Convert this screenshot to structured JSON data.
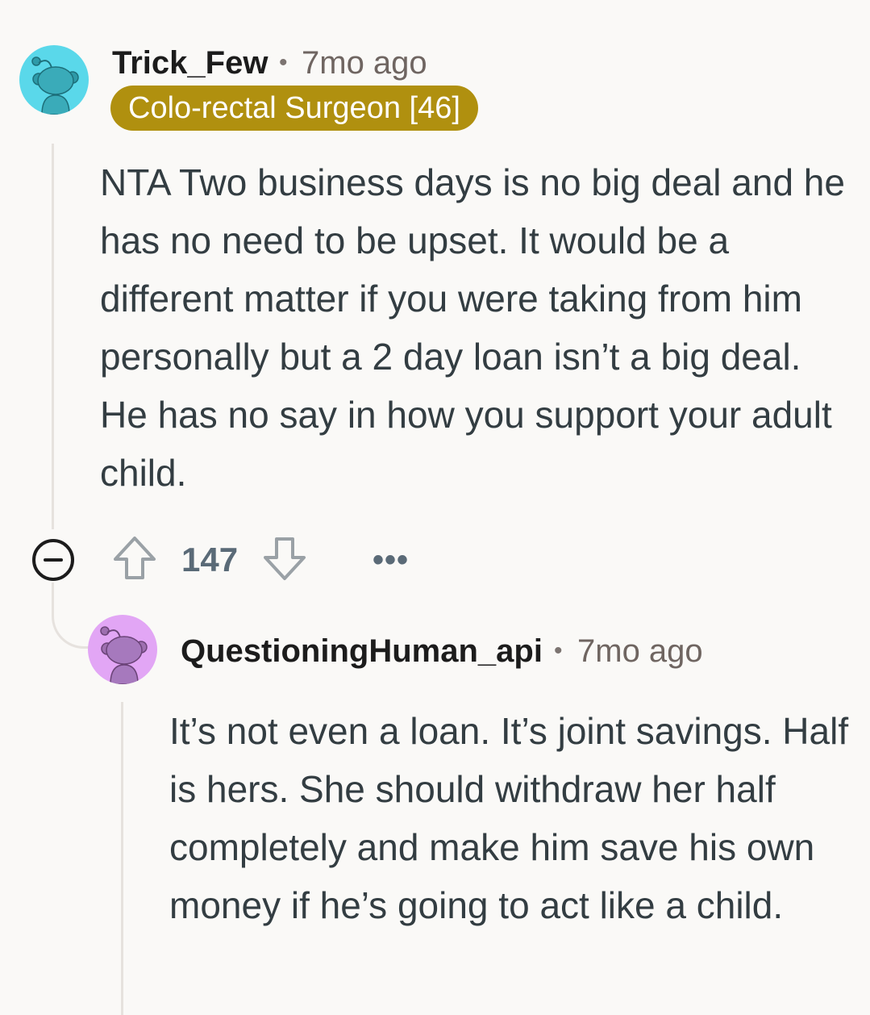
{
  "comment1": {
    "username": "Trick_Few",
    "separator": "•",
    "time": "7mo ago",
    "flair": "Colo-rectal Surgeon [46]",
    "flair_color": "#b0900f",
    "avatar_color": "#5ad8ea",
    "body": "NTA Two business days is no big deal and he has no need to be upset. It would be a different matter if you were taking from him personally but a 2 day loan isn’t a big deal. He has no say in how you support your adult child.",
    "score": "147",
    "upvote_icon": "upvote-arrow-icon",
    "downvote_icon": "downvote-arrow-icon",
    "more_label": "•••",
    "collapse_icon": "minus-circle-icon"
  },
  "comment2": {
    "username": "QuestioningHuman_api",
    "separator": "•",
    "time": "7mo ago",
    "avatar_color": "#e2a6f5",
    "body": "It’s not even a loan. It’s joint savings. Half is hers. She should withdraw her half completely and make him save his own money if he’s going to act like a child."
  }
}
